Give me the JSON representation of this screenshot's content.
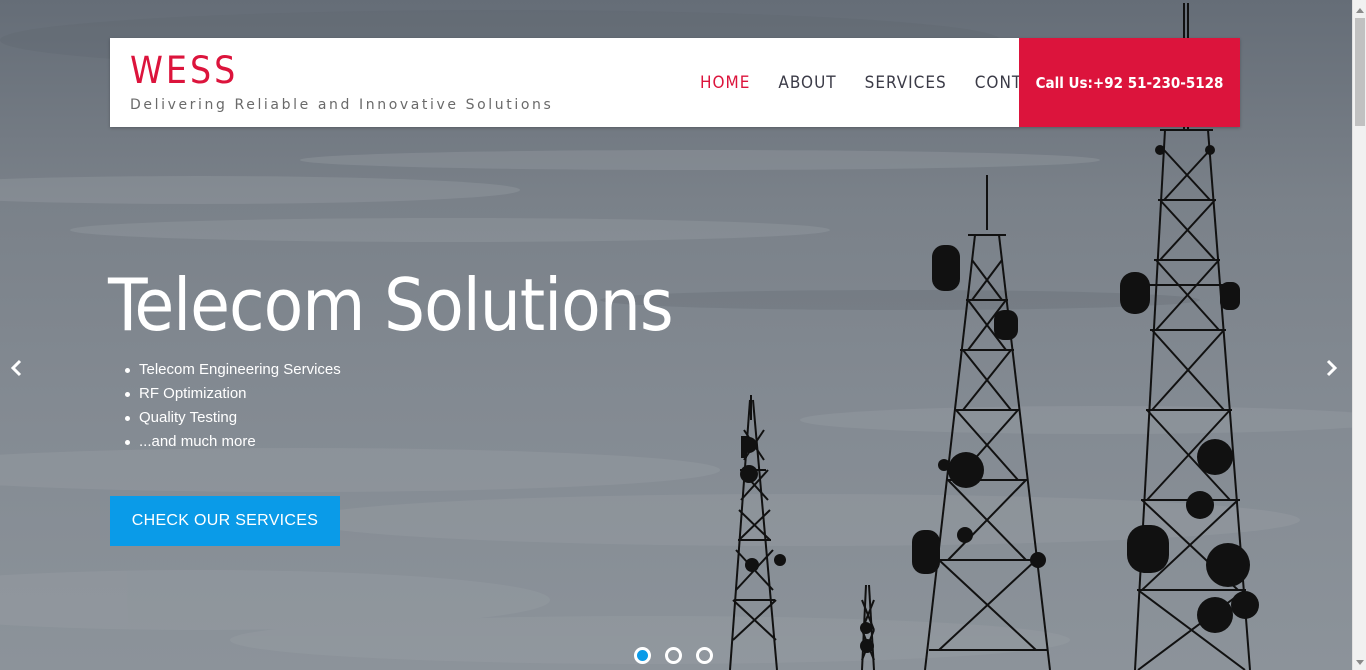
{
  "header": {
    "logo": "WESS",
    "tagline": "Delivering Reliable and Innovative Solutions",
    "nav": [
      {
        "label": "HOME",
        "active": true
      },
      {
        "label": "ABOUT",
        "active": false
      },
      {
        "label": "SERVICES",
        "active": false
      },
      {
        "label": "CONTACT",
        "active": false
      }
    ],
    "call_label": "Call Us:+92 51-230-5128"
  },
  "slide": {
    "headline": "Telecom Solutions",
    "bullets": [
      "Telecom Engineering Services",
      "RF Optimization",
      "Quality Testing",
      "...and much more"
    ],
    "cta_label": "CHECK OUR SERVICES",
    "background": "telecom-towers-photo"
  },
  "carousel": {
    "slide_count": 3,
    "active_index": 0,
    "prev_icon": "chevron-left-icon",
    "next_icon": "chevron-right-icon"
  },
  "colors": {
    "brand": "#dc143c",
    "cta": "#0a9be8",
    "nav_text": "#3b3b47"
  }
}
